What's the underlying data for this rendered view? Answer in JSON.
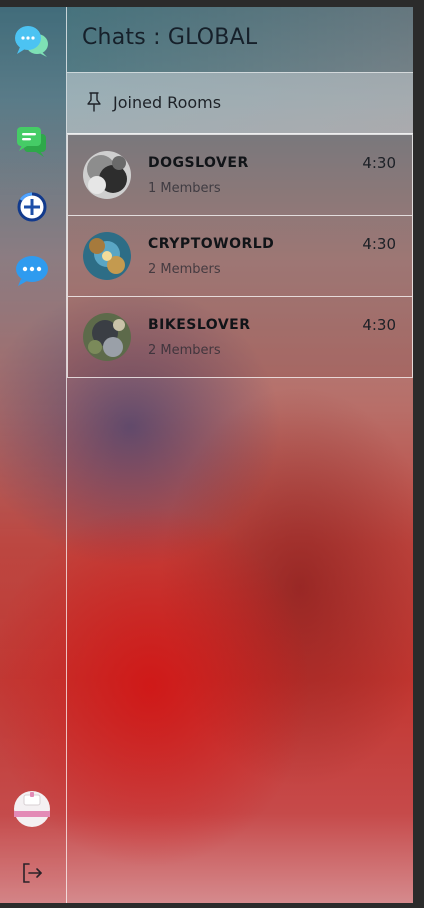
{
  "header": {
    "title": "Chats : GLOBAL"
  },
  "joined": {
    "label": "Joined Rooms"
  },
  "rooms": [
    {
      "name": "DOGSLOVER",
      "members": "1 Members",
      "time": "4:30"
    },
    {
      "name": "CRYPTOWORLD",
      "members": "2 Members",
      "time": "4:30"
    },
    {
      "name": "BIKESLOVER",
      "members": "2 Members",
      "time": "4:30"
    }
  ],
  "sidebar": {
    "icons": [
      "chat-bubbles-logo-icon",
      "chat-messages-icon",
      "add-circle-icon",
      "more-chat-icon",
      "user-avatar",
      "logout-icon"
    ]
  },
  "colors": {
    "accent_blue": "#2f9bef",
    "accent_green": "#3fbf56",
    "add_blue": "#1d4fa8"
  }
}
